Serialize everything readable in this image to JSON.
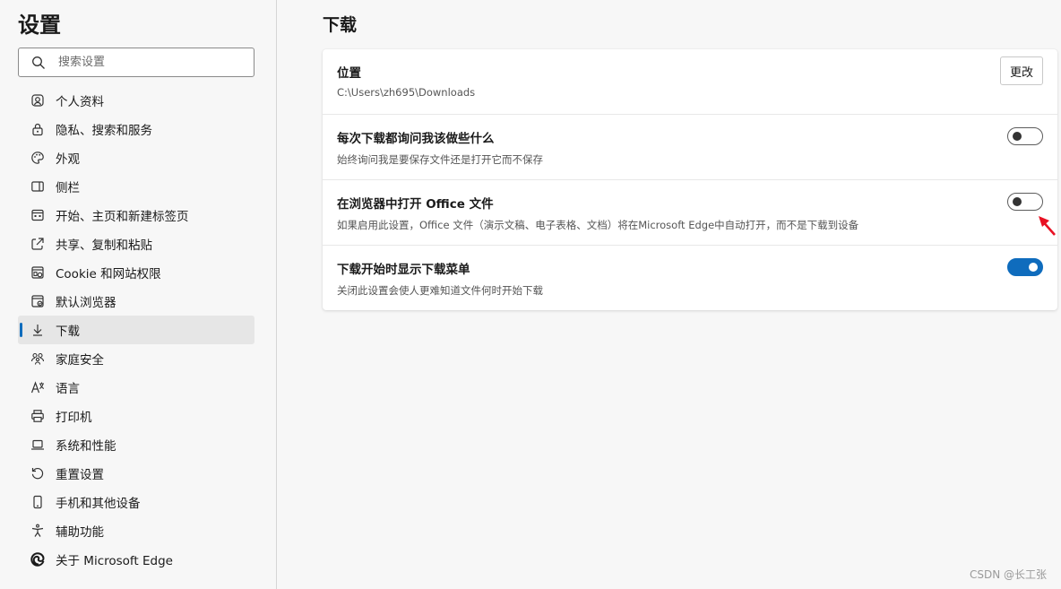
{
  "sidebar": {
    "title": "设置",
    "search_placeholder": "搜索设置",
    "items": [
      {
        "label": "个人资料",
        "icon": "profile-icon"
      },
      {
        "label": "隐私、搜索和服务",
        "icon": "lock-icon"
      },
      {
        "label": "外观",
        "icon": "palette-icon"
      },
      {
        "label": "侧栏",
        "icon": "sidebar-icon"
      },
      {
        "label": "开始、主页和新建标签页",
        "icon": "home-grid-icon"
      },
      {
        "label": "共享、复制和粘贴",
        "icon": "share-icon"
      },
      {
        "label": "Cookie 和网站权限",
        "icon": "cookie-icon"
      },
      {
        "label": "默认浏览器",
        "icon": "browser-icon"
      },
      {
        "label": "下载",
        "icon": "download-icon",
        "active": true
      },
      {
        "label": "家庭安全",
        "icon": "family-icon"
      },
      {
        "label": "语言",
        "icon": "language-icon"
      },
      {
        "label": "打印机",
        "icon": "printer-icon"
      },
      {
        "label": "系统和性能",
        "icon": "laptop-icon"
      },
      {
        "label": "重置设置",
        "icon": "reset-icon"
      },
      {
        "label": "手机和其他设备",
        "icon": "phone-icon"
      },
      {
        "label": "辅助功能",
        "icon": "accessibility-icon"
      },
      {
        "label": "关于 Microsoft Edge",
        "icon": "edge-icon"
      }
    ]
  },
  "main": {
    "title": "下载",
    "location": {
      "label": "位置",
      "path": "C:\\Users\\zh695\\Downloads",
      "button": "更改"
    },
    "settings": [
      {
        "title": "每次下载都询问我该做些什么",
        "desc": "始终询问我是要保存文件还是打开它而不保存",
        "enabled": false
      },
      {
        "title": "在浏览器中打开 Office 文件",
        "desc": "如果启用此设置，Office 文件（演示文稿、电子表格、文档）将在Microsoft Edge中自动打开，而不是下载到设备",
        "enabled": false
      },
      {
        "title": "下载开始时显示下载菜单",
        "desc": "关闭此设置会使人更难知道文件何时开始下载",
        "enabled": true
      }
    ]
  },
  "colors": {
    "accent": "#0f6cbd",
    "annotation_arrow": "#e81123"
  },
  "watermark": "CSDN @长工张"
}
